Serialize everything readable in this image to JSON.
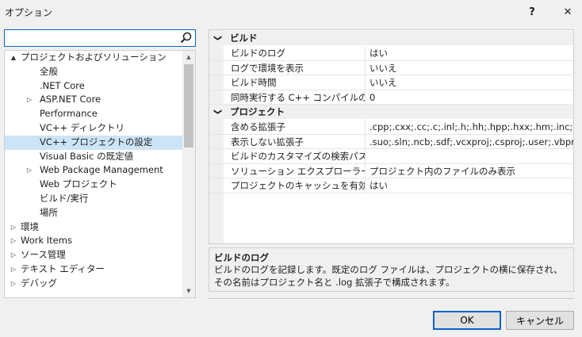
{
  "window": {
    "title": "オプション",
    "help": "?",
    "close": "✕"
  },
  "search": {
    "value": "",
    "placeholder": ""
  },
  "tree": {
    "items": [
      {
        "label": "プロジェクトおよびソリューション",
        "level": 0,
        "arrow": "▲"
      },
      {
        "label": "全般",
        "level": 1,
        "arrow": ""
      },
      {
        "label": ".NET Core",
        "level": 1,
        "arrow": ""
      },
      {
        "label": "ASP.NET Core",
        "level": 1,
        "arrow": "▷"
      },
      {
        "label": "Performance",
        "level": 1,
        "arrow": ""
      },
      {
        "label": "VC++ ディレクトリ",
        "level": 1,
        "arrow": ""
      },
      {
        "label": "VC++ プロジェクトの設定",
        "level": 1,
        "arrow": "",
        "selected": true
      },
      {
        "label": "Visual Basic の既定値",
        "level": 1,
        "arrow": ""
      },
      {
        "label": "Web Package Management",
        "level": 1,
        "arrow": "▷"
      },
      {
        "label": "Web プロジェクト",
        "level": 1,
        "arrow": ""
      },
      {
        "label": "ビルド/実行",
        "level": 1,
        "arrow": ""
      },
      {
        "label": "場所",
        "level": 1,
        "arrow": ""
      },
      {
        "label": "環境",
        "level": 0,
        "arrow": "▷"
      },
      {
        "label": "Work Items",
        "level": 0,
        "arrow": "▷"
      },
      {
        "label": "ソース管理",
        "level": 0,
        "arrow": "▷"
      },
      {
        "label": "テキスト エディター",
        "level": 0,
        "arrow": "▷"
      },
      {
        "label": "デバッグ",
        "level": 0,
        "arrow": "▷"
      }
    ],
    "scroll_up": "▲",
    "scroll_down": "▼"
  },
  "grid": {
    "categories": [
      {
        "toggle": "❯",
        "label": "ビルド",
        "rows": [
          {
            "name": "ビルドのログ",
            "value": "はい"
          },
          {
            "name": "ログで環境を表示",
            "value": "いいえ"
          },
          {
            "name": "ビルド時間",
            "value": "いいえ"
          },
          {
            "name": "同時実行する C++ コンパイルの最大",
            "value": "0"
          }
        ]
      },
      {
        "toggle": "❯",
        "label": "プロジェクト",
        "rows": [
          {
            "name": "含める拡張子",
            "value": ".cpp;.cxx;.cc;.c;.inl;.h;.hh;.hpp;.hxx;.hm;.inc;.rc;.re"
          },
          {
            "name": "表示しない拡張子",
            "value": ".suo;.sln;.ncb;.sdf;.vcxproj;.csproj;.user;.vbproj;.sc"
          },
          {
            "name": "ビルドのカスタマイズの検索パス",
            "value": ""
          },
          {
            "name": "ソリューション エクスプローラー モード",
            "value": "プロジェクト内のファイルのみ表示"
          },
          {
            "name": "プロジェクトのキャッシュを有効にする",
            "value": "はい"
          }
        ]
      }
    ]
  },
  "description": {
    "title": "ビルドのログ",
    "text": "ビルドのログを記録します。既定のログ ファイルは、プロジェクトの横に保存され、その名前はプロジェクト名と .log 拡張子で構成されます。"
  },
  "buttons": {
    "ok": "OK",
    "cancel": "キャンセル"
  }
}
